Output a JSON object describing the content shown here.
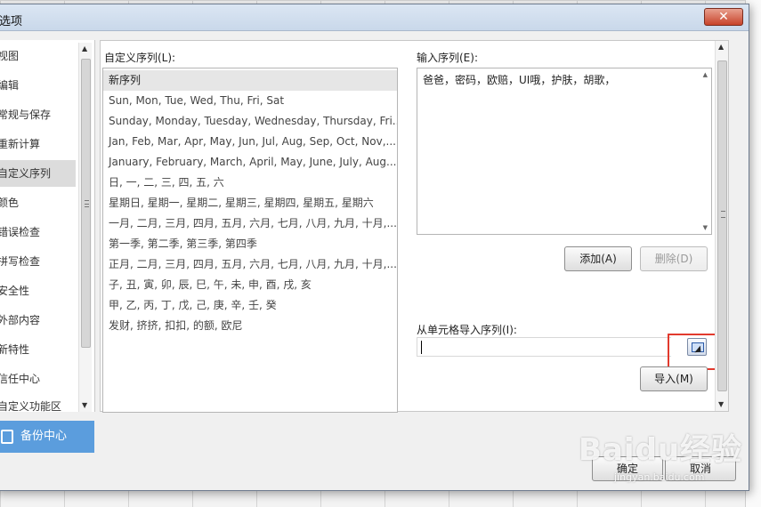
{
  "window": {
    "title": "选项",
    "close_label": "✕"
  },
  "nav": {
    "items": [
      {
        "label": "视图"
      },
      {
        "label": "编辑"
      },
      {
        "label": "常规与保存"
      },
      {
        "label": "重新计算"
      },
      {
        "label": "自定义序列",
        "selected": true
      },
      {
        "label": "颜色"
      },
      {
        "label": "错误检查"
      },
      {
        "label": "拼写检查"
      },
      {
        "label": "安全性"
      },
      {
        "label": "外部内容"
      },
      {
        "label": "新特性"
      },
      {
        "label": "信任中心"
      },
      {
        "label": "自定义功能区"
      }
    ],
    "backup_label": "备份中心"
  },
  "custom_list": {
    "label": "自定义序列(L):",
    "items": [
      "新序列",
      "Sun, Mon, Tue, Wed, Thu, Fri, Sat",
      "Sunday, Monday, Tuesday, Wednesday, Thursday, Fri...",
      "Jan, Feb, Mar, Apr, May, Jun, Jul, Aug, Sep, Oct, Nov,...",
      "January, February, March, April, May, June, July, Aug...",
      "日, 一, 二, 三, 四, 五, 六",
      "星期日, 星期一, 星期二, 星期三, 星期四, 星期五, 星期六",
      "一月, 二月, 三月, 四月, 五月, 六月, 七月, 八月, 九月, 十月,...",
      "第一季, 第二季, 第三季, 第四季",
      "正月, 二月, 三月, 四月, 五月, 六月, 七月, 八月, 九月, 十月,...",
      "子, 丑, 寅, 卯, 辰, 巳, 午, 未, 申, 酉, 戌, 亥",
      "甲, 乙, 丙, 丁, 戊, 己, 庚, 辛, 壬, 癸",
      "发财, 挤挤, 扣扣, 的额, 欧尼"
    ]
  },
  "input_sequence": {
    "label": "输入序列(E):",
    "value": "爸爸，密码，欧赔，UI哦，护肤，胡歌，"
  },
  "buttons": {
    "add": "添加(A)",
    "delete": "删除(D)",
    "import": "导入(M)",
    "ok": "确定",
    "cancel": "取消"
  },
  "import_from_cells": {
    "label": "从单元格导入序列(I):",
    "value": ""
  },
  "watermark": {
    "text": "Baidu经验",
    "url": "jingyan.baidu.com"
  },
  "colors": {
    "highlight": "#e23a2e",
    "selected_nav_bg": "#dcdcdc",
    "backup_bg": "#5b9ddd"
  }
}
